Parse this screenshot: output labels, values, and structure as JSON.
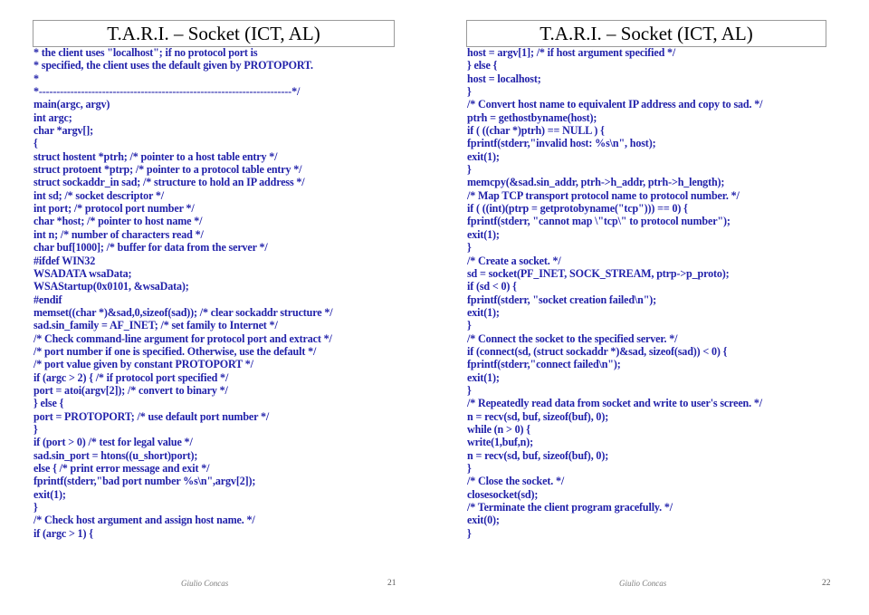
{
  "document": {
    "slide_count": 2
  },
  "slides": [
    {
      "title": "T.A.R.I. – Socket (ICT, AL)",
      "code_lines": [
        "* the client uses \"localhost\"; if no protocol port is",
        "* specified, the client uses the default given by PROTOPORT.",
        "*",
        "*------------------------------------------------------------------------*/",
        "main(argc, argv)",
        "int argc;",
        "char *argv[];",
        "{",
        "struct hostent *ptrh; /* pointer to a host table entry */",
        "struct protoent *ptrp; /* pointer to a protocol table entry */",
        "struct sockaddr_in sad; /* structure to hold an IP address */",
        "int sd; /* socket descriptor */",
        "int port; /* protocol port number */",
        "char *host; /* pointer to host name */",
        "int n; /* number of characters read */",
        "char buf[1000]; /* buffer for data from the server */",
        "#ifdef WIN32",
        "WSADATA wsaData;",
        "WSAStartup(0x0101, &wsaData);",
        "#endif",
        "memset((char *)&sad,0,sizeof(sad)); /* clear sockaddr structure */",
        "sad.sin_family = AF_INET; /* set family to Internet */",
        "/* Check command-line argument for protocol port and extract */",
        "/* port number if one is specified. Otherwise, use the default */",
        "/* port value given by constant PROTOPORT */",
        "if (argc > 2) { /* if protocol port specified */",
        "port = atoi(argv[2]); /* convert to binary */",
        "} else {",
        "port = PROTOPORT; /* use default port number */",
        "}",
        "if (port > 0) /* test for legal value */",
        "sad.sin_port = htons((u_short)port);",
        "else { /* print error message and exit */",
        "fprintf(stderr,\"bad port number %s\\n\",argv[2]);",
        "exit(1);",
        "}",
        "/* Check host argument and assign host name. */",
        "if (argc > 1) {"
      ],
      "footer": {
        "author": "Giulio Concas",
        "page": "21"
      }
    },
    {
      "title": "T.A.R.I. – Socket (ICT, AL)",
      "code_lines": [
        "host = argv[1]; /* if host argument specified */",
        "} else {",
        "host = localhost;",
        "}",
        "/* Convert host name to equivalent IP address and copy to sad. */",
        "ptrh = gethostbyname(host);",
        "if ( ((char *)ptrh) == NULL ) {",
        "fprintf(stderr,\"invalid host: %s\\n\", host);",
        "exit(1);",
        "}",
        "memcpy(&sad.sin_addr, ptrh->h_addr, ptrh->h_length);",
        "/* Map TCP transport protocol name to protocol number. */",
        "if ( ((int)(ptrp = getprotobyname(\"tcp\"))) == 0) {",
        "fprintf(stderr, \"cannot map \\\"tcp\\\" to protocol number\");",
        "exit(1);",
        "}",
        "/* Create a socket. */",
        "sd = socket(PF_INET, SOCK_STREAM, ptrp->p_proto);",
        "if (sd < 0) {",
        "fprintf(stderr, \"socket creation failed\\n\");",
        "exit(1);",
        "}",
        "/* Connect the socket to the specified server. */",
        "if (connect(sd, (struct sockaddr *)&sad, sizeof(sad)) < 0) {",
        "fprintf(stderr,\"connect failed\\n\");",
        "exit(1);",
        "}",
        "/* Repeatedly read data from socket and write to user's screen. */",
        "n = recv(sd, buf, sizeof(buf), 0);",
        "while (n > 0) {",
        "write(1,buf,n);",
        "n = recv(sd, buf, sizeof(buf), 0);",
        "}",
        "/* Close the socket. */",
        "closesocket(sd);",
        "/* Terminate the client program gracefully. */",
        "exit(0);",
        "}"
      ],
      "footer": {
        "author": "Giulio Concas",
        "page": "22"
      }
    }
  ],
  "colors": {
    "code_text": "#2222aa",
    "title_text": "#000000",
    "title_border": "#9a9a9a",
    "footer_text": "#7b7b7b",
    "background": "#ffffff"
  }
}
